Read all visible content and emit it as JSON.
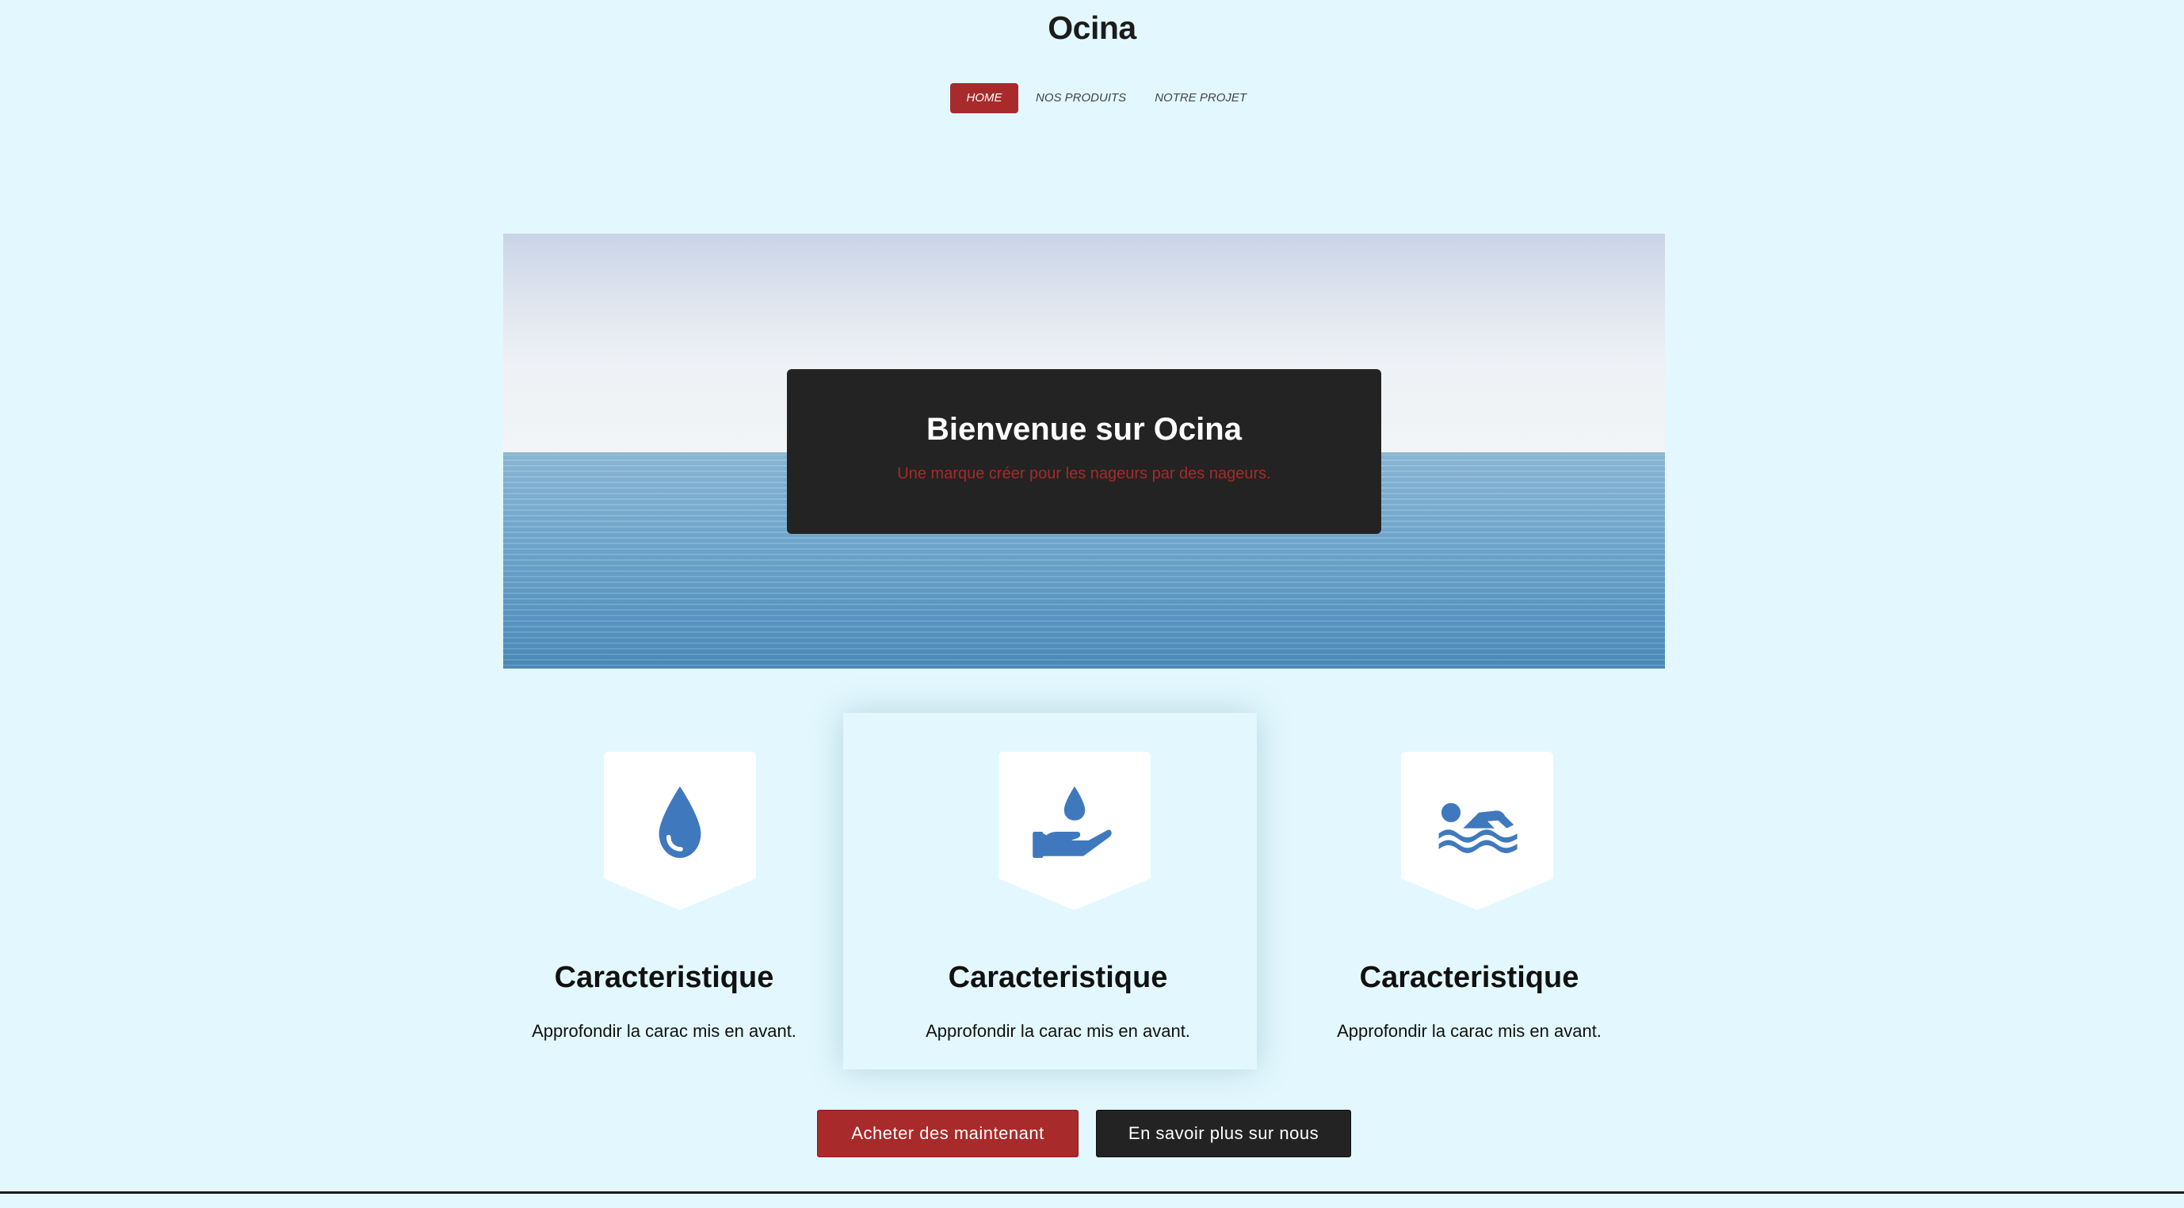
{
  "site": {
    "title": "Ocina"
  },
  "nav": {
    "items": [
      {
        "label": "HOME",
        "active": true
      },
      {
        "label": "NOS PRODUITS",
        "active": false
      },
      {
        "label": "NOTRE PROJET",
        "active": false
      }
    ]
  },
  "hero": {
    "title": "Bienvenue sur Ocina",
    "subtitle": "Une marque créer pour les nageurs par des nageurs."
  },
  "features": [
    {
      "icon": "water-drop-icon",
      "title": "Caracteristique",
      "text": "Approfondir la carac mis en avant."
    },
    {
      "icon": "hand-holding-water-icon",
      "title": "Caracteristique",
      "text": "Approfondir la carac mis en avant."
    },
    {
      "icon": "swimmer-icon",
      "title": "Caracteristique",
      "text": "Approfondir la carac mis en avant."
    }
  ],
  "buttons": {
    "buy_label": "Acheter des maintenant",
    "about_label": "En savoir plus sur nous"
  },
  "colors": {
    "background": "#e2f8fe",
    "accent_red": "#a82a2a",
    "dark": "#232323",
    "icon_blue": "#3f78bd"
  }
}
